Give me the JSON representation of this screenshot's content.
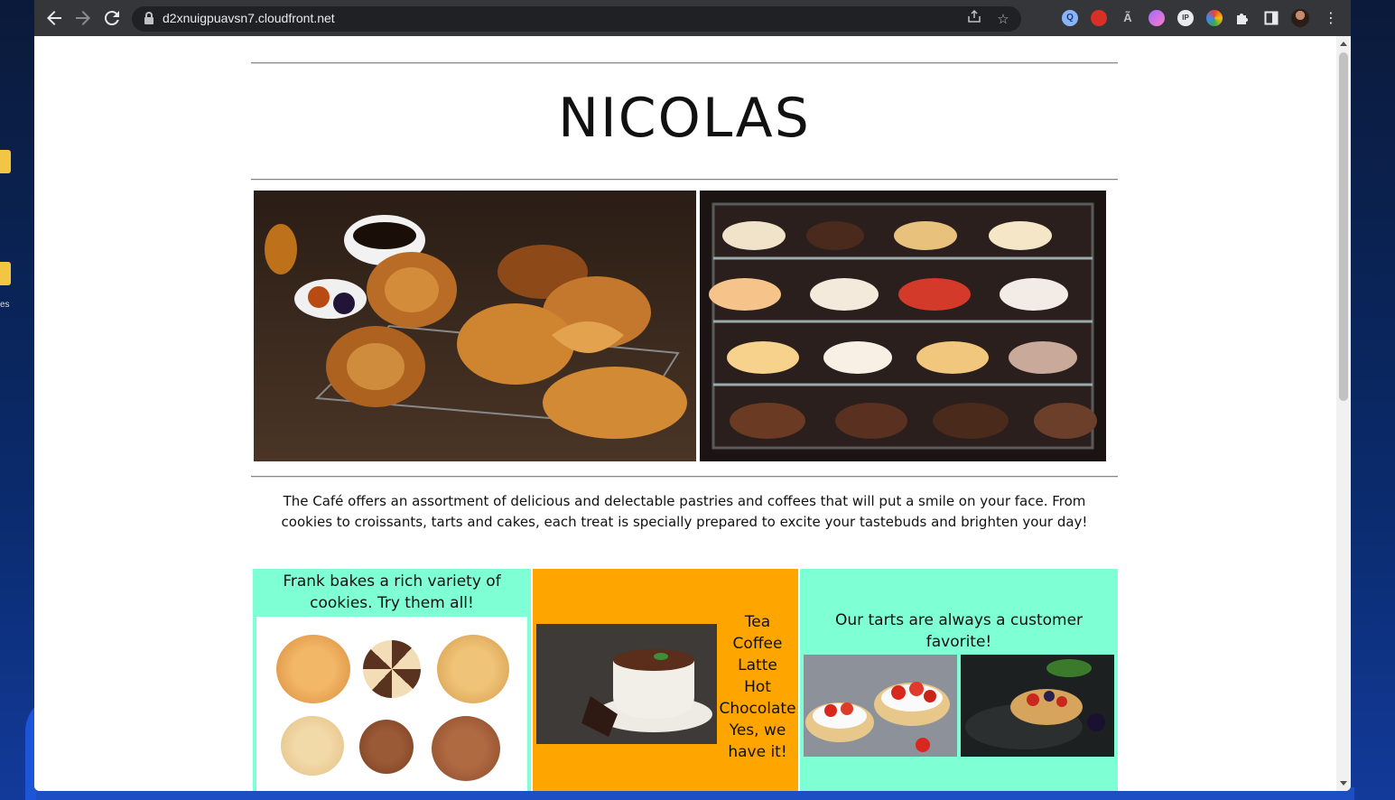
{
  "desktop": {
    "label": "es"
  },
  "browser": {
    "url": "d2xnuigpuavsn7.cloudfront.net",
    "icons": {
      "back": "arrow-left-icon",
      "forward": "arrow-right-icon",
      "reload": "reload-icon",
      "share": "share-icon",
      "bookmark": "star-icon",
      "extensions": "puzzle-icon",
      "side_panel": "side-panel-icon",
      "menu": "kebab-menu-icon"
    },
    "extension_badges": [
      "Q",
      "",
      "",
      "",
      "IP",
      "",
      ""
    ]
  },
  "site": {
    "title": "NICOLAS",
    "intro": "The Café offers an assortment of delicious and delectable pastries and coffees that will put a smile on your face. From cookies to croissants, tarts and cakes, each treat is specially prepared to excite your tastebuds and brighten your day!",
    "panels": {
      "cookies": {
        "text": "Frank bakes a rich variety of cookies. Try them all!",
        "color": "#7fffd4"
      },
      "drinks": {
        "color": "#ffa500",
        "items": [
          "Tea",
          "Coffee",
          "Latte",
          "Hot",
          "Chocolate",
          "Yes, we",
          "have it!"
        ]
      },
      "tarts": {
        "text": "Our tarts are always a customer favorite!",
        "color": "#7fffd4"
      }
    }
  }
}
